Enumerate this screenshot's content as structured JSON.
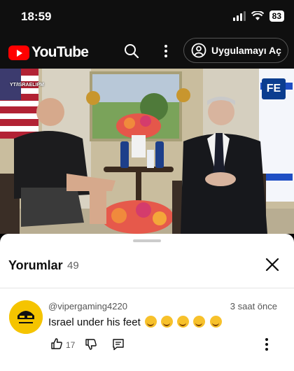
{
  "status_bar": {
    "time": "18:59",
    "battery": "83"
  },
  "header": {
    "logo_text": "YouTube",
    "open_app_label": "Uygulamayı Aç",
    "icons": [
      "search-icon",
      "more-vert-icon",
      "account-icon"
    ]
  },
  "video": {
    "watermark": "YT/ISRAELIPM",
    "badge": "FE"
  },
  "comments": {
    "title": "Yorumlar",
    "count": "49",
    "items": [
      {
        "author": "@vipergaming4220",
        "time": "3 saat önce",
        "text": "Israel under his feet",
        "emoji_count": 5,
        "likes": "17"
      }
    ]
  },
  "colors": {
    "header_bg": "#0f0f0f",
    "brand_red": "#ff0000",
    "avatar_bg": "#f5c400"
  }
}
